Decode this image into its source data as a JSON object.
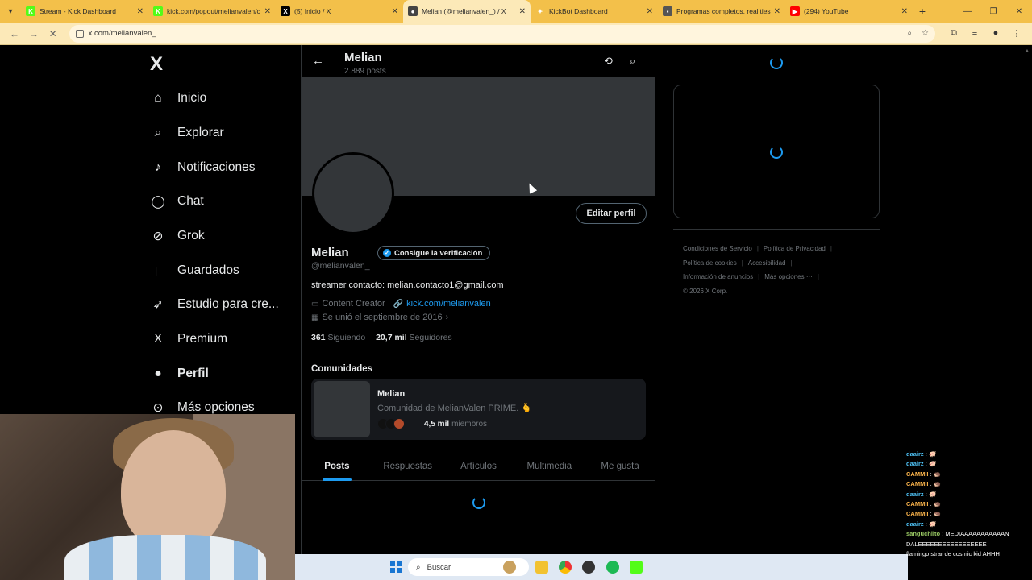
{
  "browser": {
    "tabs": [
      {
        "label": "Stream - Kick Dashboard",
        "color": "#53fc18",
        "glyph": "K"
      },
      {
        "label": "kick.com/popout/melianvalen/c",
        "color": "#53fc18",
        "glyph": "K"
      },
      {
        "label": "(5) Inicio / X",
        "color": "#000000",
        "glyph": "X"
      },
      {
        "label": "Melian (@melianvalen_) / X",
        "color": "#444444",
        "glyph": "●"
      },
      {
        "label": "KickBot Dashboard",
        "color": "#f3c04a",
        "glyph": "✦"
      },
      {
        "label": "Programas completos, realities",
        "color": "#555555",
        "glyph": "▪"
      },
      {
        "label": "(294) YouTube",
        "color": "#ff0000",
        "glyph": "▶"
      }
    ],
    "active_tab": 3,
    "url": "x.com/melianvalen_"
  },
  "nav": {
    "logo": "X",
    "items": [
      {
        "label": "Inicio",
        "icon": "home-icon",
        "bold": false
      },
      {
        "label": "Explorar",
        "icon": "search-icon",
        "bold": false
      },
      {
        "label": "Notificaciones",
        "icon": "bell-icon",
        "bold": false
      },
      {
        "label": "Chat",
        "icon": "chat-icon",
        "bold": false
      },
      {
        "label": "Grok",
        "icon": "grok-icon",
        "bold": false
      },
      {
        "label": "Guardados",
        "icon": "bookmark-icon",
        "bold": false
      },
      {
        "label": "Estudio para cre...",
        "icon": "rocket-icon",
        "bold": false
      },
      {
        "label": "Premium",
        "icon": "x-premium-icon",
        "bold": false
      },
      {
        "label": "Perfil",
        "icon": "person-icon",
        "bold": true
      },
      {
        "label": "Más opciones",
        "icon": "more-icon",
        "bold": false
      }
    ]
  },
  "profile": {
    "header_name": "Melian",
    "post_count": "2.889 posts",
    "name": "Melian",
    "verify_label": "Consigue la verificación",
    "handle": "@melianvalen_",
    "edit_label": "Editar perfil",
    "bio": "streamer contacto: melian.contacto1@gmail.com",
    "category": "Content Creator",
    "link": "kick.com/melianvalen",
    "joined": "Se unió el septiembre de 2016",
    "following_count": "361",
    "following_label": "Siguiendo",
    "followers_count": "20,7 mil",
    "followers_label": "Seguidores"
  },
  "communities": {
    "title": "Comunidades",
    "card": {
      "name": "Melian",
      "description": "Comunidad de MelianValen PRIME. 🫰",
      "members_count": "4,5 mil",
      "members_label": "miembros"
    }
  },
  "tabs": [
    "Posts",
    "Respuestas",
    "Artículos",
    "Multimedia",
    "Me gusta"
  ],
  "active_profile_tab": 0,
  "footer": {
    "links": [
      "Condiciones de Servicio",
      "Política de Privacidad",
      "Política de cookies",
      "Accesibilidad",
      "Información de anuncios",
      "Más opciones ···"
    ],
    "copyright": "© 2026 X Corp."
  },
  "taskbar": {
    "search_placeholder": "Buscar"
  },
  "chat": [
    {
      "user": "daairz",
      "text": ": 🐖",
      "cls": "u1"
    },
    {
      "user": "daairz",
      "text": ": 🐖",
      "cls": "u1"
    },
    {
      "user": "CAMMII",
      "text": ": 🦔",
      "cls": "u2"
    },
    {
      "user": "CAMMII",
      "text": ": 🦔",
      "cls": "u2"
    },
    {
      "user": "daairz",
      "text": ": 🐖",
      "cls": "u1"
    },
    {
      "user": "CAMMII",
      "text": ": 🦔",
      "cls": "u2"
    },
    {
      "user": "CAMMII",
      "text": ": 🦔",
      "cls": "u2"
    },
    {
      "user": "daairz",
      "text": ": 🐖",
      "cls": "u1"
    },
    {
      "user": "sanguchiito",
      "text": ": MEDIAAAAAAAAAAAN",
      "cls": "u3"
    },
    {
      "user": "",
      "text": "DALEEEEEEEEEEEEEEEEE",
      "cls": ""
    },
    {
      "user": "",
      "text": "flamingo strar de cosmic kid AHHH",
      "cls": ""
    }
  ]
}
